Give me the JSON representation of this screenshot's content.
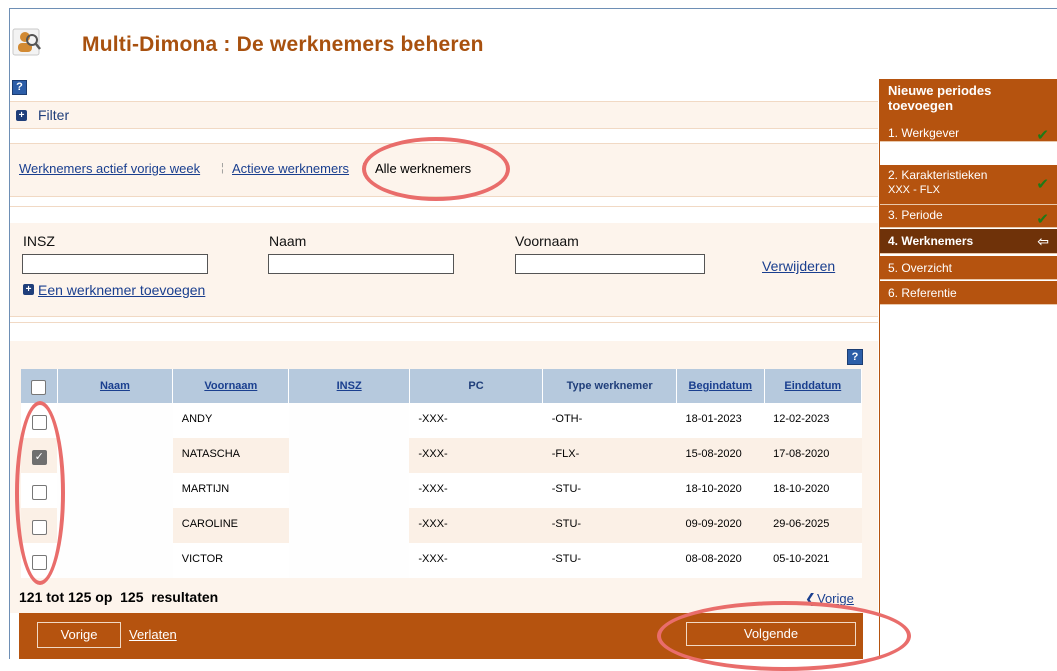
{
  "header": {
    "title": "Multi-Dimona : De werknemers beheren",
    "icon": "person-search-icon"
  },
  "filter": {
    "label": "Filter",
    "icon": "plus-icon"
  },
  "tabs": [
    {
      "label": "Werknemers actief vorige week",
      "active": false
    },
    {
      "label": "Actieve werknemers",
      "active": false
    },
    {
      "label": "Alle werknemers",
      "active": true
    }
  ],
  "search": {
    "insz_label": "INSZ",
    "insz_value": "",
    "naam_label": "Naam",
    "naam_value": "",
    "voornaam_label": "Voornaam",
    "voornaam_value": "",
    "remove_link": "Verwijderen",
    "add_link": "Een werknemer toevoegen"
  },
  "table": {
    "headers": {
      "naam": "Naam",
      "voornaam": "Voornaam",
      "insz": "INSZ",
      "pc": "PC",
      "type": "Type werknemer",
      "begin": "Begindatum",
      "eind": "Einddatum"
    },
    "rows": [
      {
        "checked": false,
        "naam": "",
        "voornaam": "ANDY",
        "insz": "",
        "pc": "-XXX-",
        "type": "-OTH-",
        "begin": "18-01-2023",
        "eind": "12-02-2023"
      },
      {
        "checked": true,
        "naam": "",
        "voornaam": "NATASCHA",
        "insz": "",
        "pc": "-XXX-",
        "type": "-FLX-",
        "begin": "15-08-2020",
        "eind": "17-08-2020"
      },
      {
        "checked": false,
        "naam": "",
        "voornaam": "MARTIJN",
        "insz": "",
        "pc": "-XXX-",
        "type": "-STU-",
        "begin": "18-10-2020",
        "eind": "18-10-2020"
      },
      {
        "checked": false,
        "naam": "",
        "voornaam": "CAROLINE",
        "insz": "",
        "pc": "-XXX-",
        "type": "-STU-",
        "begin": "09-09-2020",
        "eind": "29-06-2025"
      },
      {
        "checked": false,
        "naam": "",
        "voornaam": "VICTOR",
        "insz": "",
        "pc": "-XXX-",
        "type": "-STU-",
        "begin": "08-08-2020",
        "eind": "05-10-2021"
      }
    ]
  },
  "pagination": {
    "summary": "121 tot 125 op  125  resultaten",
    "prev_link": "Vorige"
  },
  "buttons": {
    "prev": "Vorige",
    "leave": "Verlaten",
    "next": "Volgende"
  },
  "wizard": {
    "title": "Nieuwe periodes toevoegen",
    "steps": [
      {
        "label": "1. Werkgever",
        "sub": "",
        "state": "done"
      },
      {
        "label": "2. Karakteristieken",
        "sub": "XXX  -  FLX",
        "state": "done"
      },
      {
        "label": "3. Periode",
        "sub": "",
        "state": "done"
      },
      {
        "label": "4. Werknemers",
        "sub": "",
        "state": "current"
      },
      {
        "label": "5. Overzicht",
        "sub": "",
        "state": "todo"
      },
      {
        "label": "6. Referentie",
        "sub": "",
        "state": "todo"
      }
    ]
  },
  "colors": {
    "accent": "#b5530f",
    "dark_accent": "#6f3209",
    "annotation": "#e96d6b",
    "table_header": "#b6c9dd"
  }
}
